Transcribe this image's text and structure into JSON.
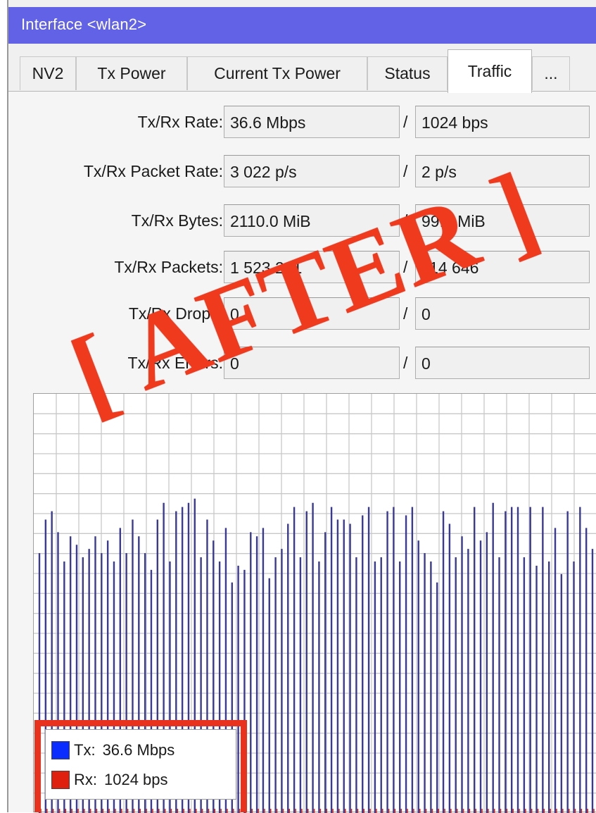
{
  "window": {
    "title": "Interface <wlan2>"
  },
  "tabs": [
    {
      "label": "NV2",
      "active": false
    },
    {
      "label": "Tx Power",
      "active": false
    },
    {
      "label": "Current Tx Power",
      "active": false
    },
    {
      "label": "Status",
      "active": false
    },
    {
      "label": "Traffic",
      "active": true
    },
    {
      "label": "...",
      "active": false
    }
  ],
  "stats": [
    {
      "label": "Tx/Rx Rate:",
      "tx": "36.6 Mbps",
      "separator": "/",
      "rx": "1024 bps"
    },
    {
      "label": "Tx/Rx Packet Rate:",
      "tx": "3 022 p/s",
      "separator": "/",
      "rx": "2 p/s"
    },
    {
      "label": "Tx/Rx Bytes:",
      "tx": "2110.0 MiB",
      "separator": "/",
      "rx": "99.3 MiB"
    },
    {
      "label": "Tx/Rx Packets:",
      "tx": "1 523 281",
      "separator": "/",
      "rx": "114 646"
    },
    {
      "label": "Tx/Rx Drops:",
      "tx": "0",
      "separator": "/",
      "rx": "0"
    },
    {
      "label": "Tx/Rx Errors:",
      "tx": "0",
      "separator": "/",
      "rx": "0"
    }
  ],
  "legend": {
    "tx": {
      "label": "Tx:",
      "value": "36.6 Mbps",
      "color": "#0a2cff"
    },
    "rx": {
      "label": "Rx:",
      "value": "1024 bps",
      "color": "#e0200e"
    }
  },
  "overlay": {
    "stamp_text": "[ AFTER ]",
    "stamp_color": "#ef3a1e",
    "highlight_color": "#e8321e"
  },
  "chart_data": {
    "type": "bar",
    "series": [
      {
        "color": "#3a3a96",
        "values": [
          0.62,
          0.7,
          0.72,
          0.67,
          0.6,
          0.66,
          0.64,
          0.61,
          0.63,
          0.66,
          0.62,
          0.65,
          0.6,
          0.68,
          0.62,
          0.7,
          0.66,
          0.62,
          0.58,
          0.7,
          0.74,
          0.6,
          0.72,
          0.73,
          0.74,
          0.75,
          0.61,
          0.7,
          0.65,
          0.6,
          0.68,
          0.55,
          0.59,
          0.58,
          0.67,
          0.66,
          0.68,
          0.56,
          0.61,
          0.63,
          0.69,
          0.73,
          0.61,
          0.72,
          0.74,
          0.6,
          0.67,
          0.73,
          0.7,
          0.7,
          0.69,
          0.61,
          0.71,
          0.73,
          0.6,
          0.61,
          0.72,
          0.73,
          0.6,
          0.71,
          0.73,
          0.65,
          0.62,
          0.6,
          0.55,
          0.72,
          0.69,
          0.61,
          0.66,
          0.63,
          0.73,
          0.65,
          0.67,
          0.74,
          0.61,
          0.72,
          0.73,
          0.73,
          0.61,
          0.73,
          0.59,
          0.73,
          0.6,
          0.68,
          0.57,
          0.72,
          0.6,
          0.73,
          0.68,
          0.63
        ]
      },
      {
        "color": "#e0200e",
        "values": [
          0.01,
          0.01,
          0.01,
          0.01,
          0.01,
          0.01,
          0.01,
          0.01,
          0.01,
          0.01,
          0.01,
          0.01,
          0.01,
          0.01,
          0.01,
          0.01,
          0.01,
          0.01,
          0.01,
          0.01,
          0.01,
          0.01,
          0.01,
          0.01,
          0.01,
          0.01,
          0.01,
          0.01,
          0.01,
          0.01,
          0.01,
          0.01,
          0.01,
          0.01,
          0.01,
          0.01,
          0.01,
          0.01,
          0.01,
          0.01,
          0.01,
          0.01,
          0.01,
          0.01,
          0.01,
          0.01,
          0.01,
          0.01,
          0.01,
          0.01,
          0.01,
          0.01,
          0.01,
          0.01,
          0.01,
          0.01,
          0.01,
          0.01,
          0.01,
          0.01,
          0.01,
          0.01,
          0.01,
          0.01,
          0.01,
          0.01,
          0.01,
          0.01,
          0.01,
          0.01,
          0.01,
          0.01,
          0.01,
          0.01,
          0.01,
          0.01,
          0.01,
          0.01,
          0.01,
          0.01,
          0.01,
          0.01,
          0.01,
          0.01,
          0.01,
          0.01,
          0.01,
          0.01,
          0.01,
          0.01
        ]
      }
    ],
    "ylim": [
      0,
      1
    ],
    "grid": true
  }
}
